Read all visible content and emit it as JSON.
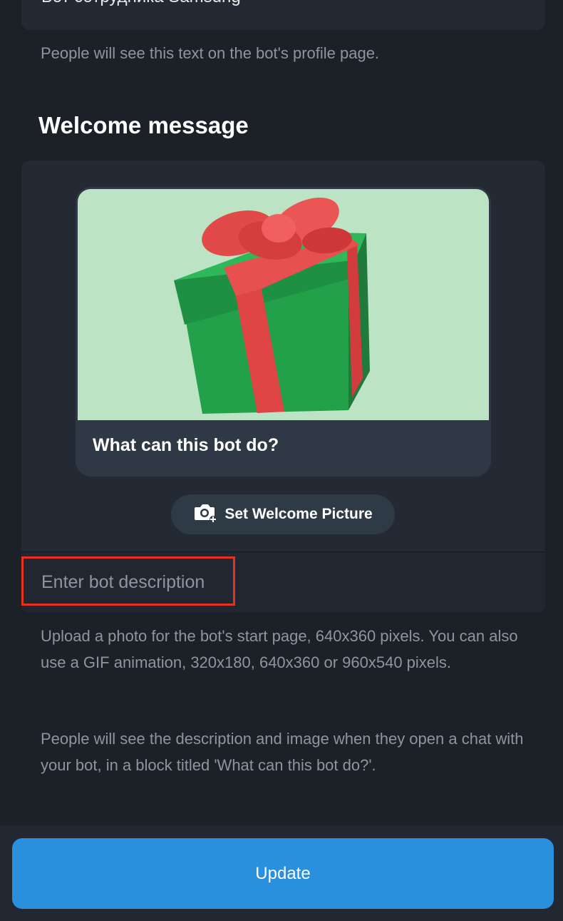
{
  "about": {
    "value": "Бот сотрудника Samsung",
    "hint": "People will see this text on the bot's profile page."
  },
  "welcome": {
    "title": "Welcome message",
    "preview_caption": "What can this bot do?",
    "picture_icon": "gift-box-image",
    "set_picture_label": "Set Welcome Picture",
    "set_picture_icon": "camera-plus-icon",
    "description_placeholder": "Enter bot description",
    "hint_upload": "Upload a photo for the bot's start page, 640x360 pixels. You can also use a GIF animation, 320x180, 640x360 or 960x540 pixels.",
    "hint_visibility": "People will see the description and image when they open a chat with your bot, in a block titled 'What can this bot do?'."
  },
  "footer": {
    "update_label": "Update"
  },
  "colors": {
    "accent": "#2a8fdd",
    "highlight": "#e8321f",
    "background": "#1c2027"
  }
}
